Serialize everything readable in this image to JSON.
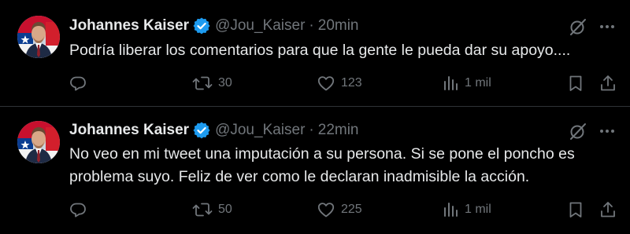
{
  "colors": {
    "background": "#000000",
    "text_primary": "#e7e9ea",
    "text_secondary": "#71767b",
    "verified_badge": "#1d9bf0",
    "divider": "#2f3336"
  },
  "tweets": [
    {
      "author_name": "Johannes Kaiser",
      "handle": "@Jou_Kaiser",
      "separator": "·",
      "time": "20min",
      "text": "Podría liberar los comentarios para que la gente le pueda dar su apoyo....",
      "reply_count": "",
      "retweet_count": "30",
      "like_count": "123",
      "view_count": "1 mil",
      "icons": {
        "avatar": "avatar-photo",
        "verified": "verified-badge-icon",
        "grok": "grok-icon",
        "more": "more-dots-icon",
        "reply": "reply-icon",
        "retweet": "retweet-icon",
        "like": "heart-icon",
        "views": "views-bar-chart-icon",
        "bookmark": "bookmark-icon",
        "share": "share-icon"
      }
    },
    {
      "author_name": "Johannes Kaiser",
      "handle": "@Jou_Kaiser",
      "separator": "·",
      "time": "22min",
      "text": "No veo en mi tweet una imputación a su persona. Si se pone el poncho es problema suyo. Feliz de ver como le declaran inadmisible la acción.",
      "reply_count": "",
      "retweet_count": "50",
      "like_count": "225",
      "view_count": "1 mil",
      "icons": {
        "avatar": "avatar-photo",
        "verified": "verified-badge-icon",
        "grok": "grok-icon",
        "more": "more-dots-icon",
        "reply": "reply-icon",
        "retweet": "retweet-icon",
        "like": "heart-icon",
        "views": "views-bar-chart-icon",
        "bookmark": "bookmark-icon",
        "share": "share-icon"
      }
    }
  ]
}
